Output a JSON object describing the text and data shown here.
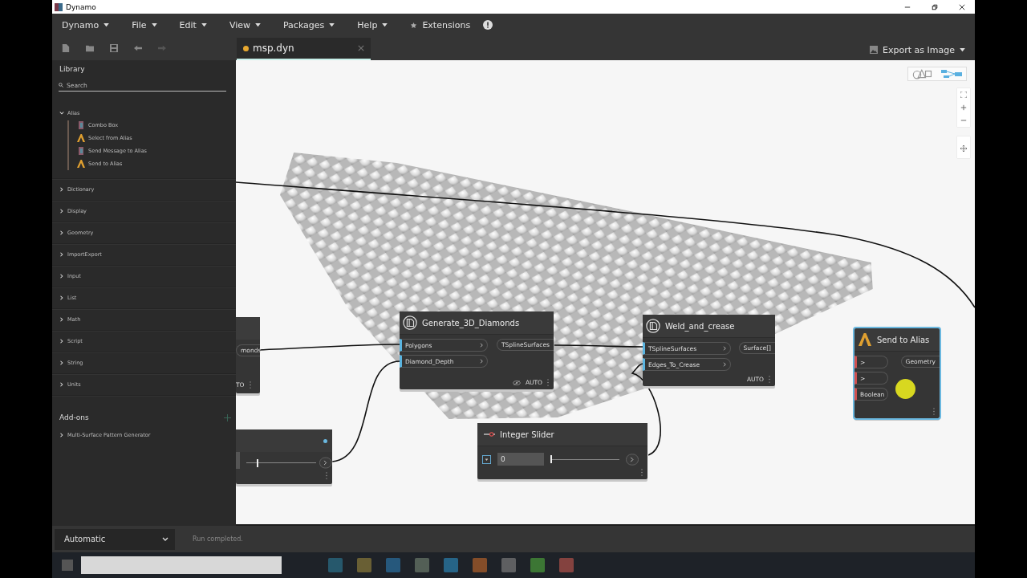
{
  "window": {
    "title": "Dynamo"
  },
  "menu": [
    {
      "label": "Dynamo",
      "dropdown": true
    },
    {
      "label": "File",
      "dropdown": true
    },
    {
      "label": "Edit",
      "dropdown": true
    },
    {
      "label": "View",
      "dropdown": true
    },
    {
      "label": "Packages",
      "dropdown": true
    },
    {
      "label": "Help",
      "dropdown": true
    },
    {
      "label": "Extensions",
      "dropdown": false
    }
  ],
  "tab": {
    "label": "msp.dyn",
    "modified": true
  },
  "export_button": {
    "label": "Export as Image"
  },
  "library": {
    "title": "Library",
    "search": {
      "placeholder": "Search"
    },
    "categories": [
      {
        "label": "Alias",
        "expanded": true,
        "children": [
          {
            "label": "Combo Box",
            "kind": "node"
          },
          {
            "label": "Select from Alias",
            "kind": "alias"
          },
          {
            "label": "Send Message to Alias",
            "kind": "node"
          },
          {
            "label": "Send to Alias",
            "kind": "alias"
          }
        ]
      },
      {
        "label": "Dictionary",
        "expanded": false
      },
      {
        "label": "Display",
        "expanded": false
      },
      {
        "label": "Geometry",
        "expanded": false
      },
      {
        "label": "ImportExport",
        "expanded": false
      },
      {
        "label": "Input",
        "expanded": false
      },
      {
        "label": "List",
        "expanded": false
      },
      {
        "label": "Math",
        "expanded": false
      },
      {
        "label": "Script",
        "expanded": false
      },
      {
        "label": "String",
        "expanded": false
      },
      {
        "label": "Units",
        "expanded": false
      }
    ],
    "addons_title": "Add-ons",
    "addons": [
      {
        "label": "Multi-Surface Pattern Generator",
        "expanded": false
      }
    ]
  },
  "nodes": [
    {
      "kind": "partial",
      "selected": false,
      "outputs": [
        "monds"
      ],
      "footer": "TO"
    },
    {
      "kind": "slider_partial",
      "selected": false,
      "level": 0.15
    },
    {
      "kind": "custom",
      "title": "Generate_3D_Diamonds",
      "selected": false,
      "inputs": [
        {
          "name": "Polygons",
          "connected": true
        },
        {
          "name": "Diamond_Depth",
          "connected": true
        }
      ],
      "outputs": [
        "TSplineSurfaces"
      ],
      "footer": "AUTO",
      "preview_hidden": true
    },
    {
      "kind": "integer_slider",
      "title": "Integer Slider",
      "selected": false,
      "value": "0",
      "level": 0
    },
    {
      "kind": "custom",
      "title": "Weld_and_crease",
      "selected": false,
      "inputs": [
        {
          "name": "TSplineSurfaces",
          "connected": true
        },
        {
          "name": "Edges_To_Crease",
          "connected": true
        }
      ],
      "outputs": [
        "Surface[]"
      ],
      "footer": "AUTO",
      "preview_hidden": false
    },
    {
      "kind": "alias",
      "title": "Send to Alias",
      "selected": true,
      "inputs": [
        {
          "name": ">",
          "connected": false
        },
        {
          "name": ">",
          "connected": false
        },
        {
          "name": "Boolean",
          "connected": false
        }
      ],
      "outputs": [
        "Geometry"
      ]
    }
  ],
  "run_mode": "Automatic",
  "status": "Run completed."
}
